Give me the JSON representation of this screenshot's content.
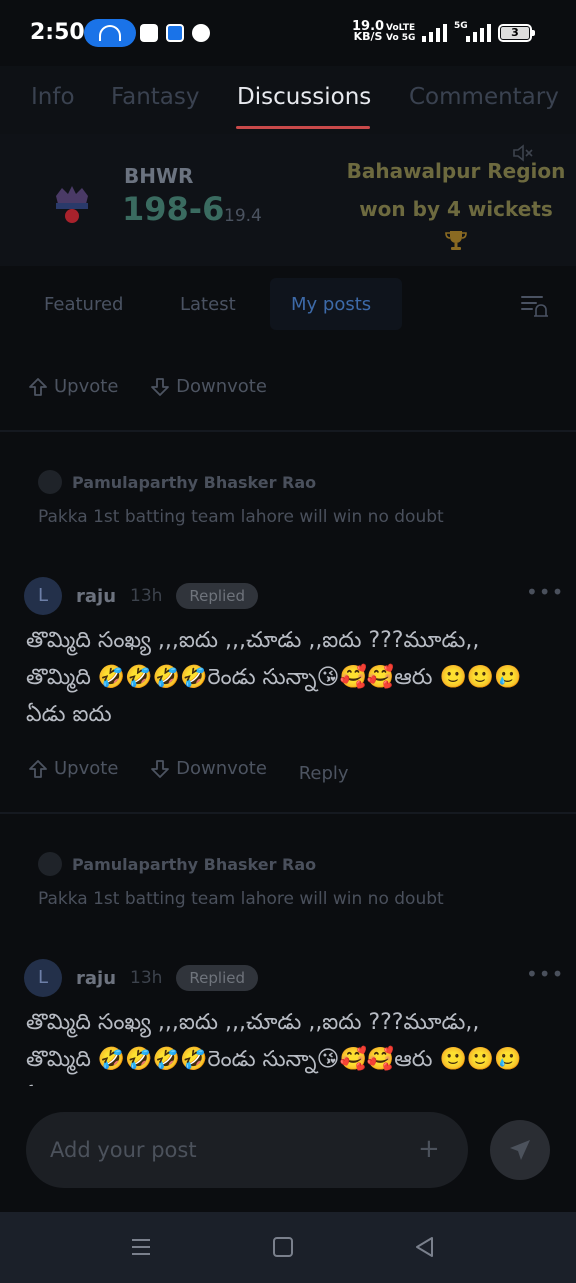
{
  "status_bar": {
    "time": "2:50",
    "speed_value": "19.0",
    "speed_unit": "KB/S",
    "volte_top": "VoLTE",
    "volte_bottom": "Vo 5G",
    "net_label": "5G",
    "battery": "3"
  },
  "top_tabs": [
    {
      "label": "Info",
      "active": false
    },
    {
      "label": "Fantasy",
      "active": false
    },
    {
      "label": "Discussions",
      "active": true
    },
    {
      "label": "Commentary",
      "active": false
    }
  ],
  "scorecard": {
    "team_abbr": "BHWR",
    "score": "198-6",
    "overs": "19.4",
    "result_line1": "Bahawalpur Region",
    "result_line2": "won by 4 wickets"
  },
  "sub_tabs": [
    {
      "label": "Featured",
      "active": false
    },
    {
      "label": "Latest",
      "active": false
    },
    {
      "label": "My posts",
      "active": true
    }
  ],
  "actions": {
    "upvote": "Upvote",
    "downvote": "Downvote",
    "reply": "Reply"
  },
  "posts": [
    {
      "quote_author": "Pamulaparthy Bhasker Rao",
      "quote_text": "Pakka 1st batting team lahore will win no doubt",
      "avatar_letter": "L",
      "user": "raju",
      "time": "13h",
      "badge": "Replied",
      "body": "తొమ్మిది సంఖ్య ,,,ఐదు ,,,చూడు ,,ఐదు ???మూడు,, తొమ్మిది 🤣🤣🤣🤣రెండు సున్నా😘🥰🥰ఆరు 🙂🙂🥲 ఏడు ఐదు"
    },
    {
      "quote_author": "Pamulaparthy Bhasker Rao",
      "quote_text": "Pakka 1st batting team lahore will win no doubt",
      "avatar_letter": "L",
      "user": "raju",
      "time": "13h",
      "badge": "Replied",
      "body": "తొమ్మిది సంఖ్య ,,,ఐదు ,,,చూడు ,,ఐదు ???మూడు,, తొమ్మిది 🤣🤣🤣🤣రెండు సున్నా😘🥰🥰ఆరు 🙂🙂🥲 ఏడు ఐదు"
    }
  ],
  "composer": {
    "placeholder": "Add your post"
  },
  "icons": {
    "status_pill": "wifi-hotspot-icon",
    "status_apps": [
      "notes-icon",
      "hotspot-icon",
      "phone-call-icon"
    ],
    "mute": "volume-mute-icon",
    "trophy": "trophy-icon",
    "filter": "filter-notification-icon",
    "upvote": "upvote-arrow-icon",
    "downvote": "downvote-arrow-icon",
    "more": "more-horizontal-icon",
    "add": "plus-icon",
    "send": "send-icon",
    "nav": [
      "menu-icon",
      "home-square-icon",
      "back-triangle-icon"
    ]
  },
  "colors": {
    "accent_underline": "#c94a4a",
    "score": "#3a6b60",
    "result_text": "#6d6a3f",
    "active_subtab": "#3d6aa8"
  }
}
